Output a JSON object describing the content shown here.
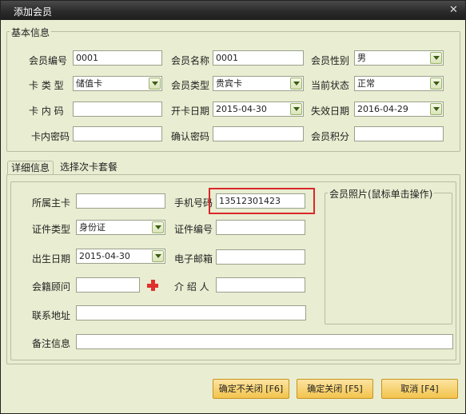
{
  "window": {
    "title": "添加会员",
    "close_label": "✕"
  },
  "basic": {
    "group_title": "基本信息",
    "member_no": {
      "label": "会员编号",
      "value": "0001"
    },
    "member_name": {
      "label": "会员名称",
      "value": "0001"
    },
    "gender": {
      "label": "会员性别",
      "value": "男"
    },
    "card_type": {
      "label": "卡 类 型",
      "value": "储值卡"
    },
    "member_type": {
      "label": "会员类型",
      "value": "贵宾卡"
    },
    "status": {
      "label": "当前状态",
      "value": "正常"
    },
    "card_code": {
      "label": "卡 内 码",
      "value": ""
    },
    "open_date": {
      "label": "开卡日期",
      "value": "2015-04-30"
    },
    "expire_date": {
      "label": "失效日期",
      "value": "2016-04-29"
    },
    "card_password": {
      "label": "卡内密码",
      "value": ""
    },
    "confirm_password": {
      "label": "确认密码",
      "value": ""
    },
    "points": {
      "label": "会员积分",
      "value": ""
    }
  },
  "tabs": [
    {
      "label": "详细信息",
      "active": true
    },
    {
      "label": "选择次卡套餐",
      "active": false
    }
  ],
  "detail": {
    "main_card": {
      "label": "所属主卡",
      "value": ""
    },
    "phone": {
      "label": "手机号码",
      "value": "13512301423"
    },
    "id_type": {
      "label": "证件类型",
      "value": "身份证"
    },
    "id_no": {
      "label": "证件编号",
      "value": ""
    },
    "birth_date": {
      "label": "出生日期",
      "value": "2015-04-30"
    },
    "email": {
      "label": "电子邮箱",
      "value": ""
    },
    "advisor": {
      "label": "会籍顾问",
      "value": ""
    },
    "referrer": {
      "label": "介 绍 人",
      "value": ""
    },
    "address": {
      "label": "联系地址",
      "value": ""
    },
    "remark": {
      "label": "备注信息",
      "value": ""
    },
    "photo_group_title": "会员照片(鼠标单击操作)"
  },
  "buttons": {
    "confirm_keep": "确定不关闭 [F6]",
    "confirm_close": "确定关闭 [F5]",
    "cancel": "取消 [F4]"
  },
  "colors": {
    "highlight": "#d9282b",
    "add_icon": "#e0302c",
    "button": "#f3c44d"
  }
}
